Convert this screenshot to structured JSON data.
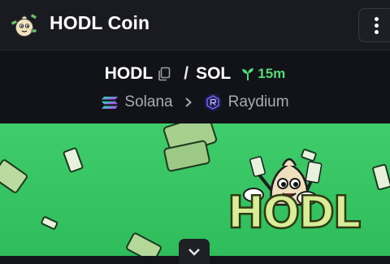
{
  "header": {
    "title": "HODL Coin",
    "logo_icon": "hodl-mascot-icon",
    "menu_icon": "kebab-menu-icon"
  },
  "pair": {
    "base": "HODL",
    "separator": "/",
    "quote": "SOL",
    "age": "15m",
    "copy_icon": "copy-icon",
    "age_icon": "sprout-icon"
  },
  "chain": {
    "network": "Solana",
    "network_icon": "solana-icon",
    "dex": "Raydium",
    "dex_icon": "raydium-icon",
    "arrow_icon": "chevron-right-icon"
  },
  "banner": {
    "brand_text": "HODL",
    "background_color": "#3ecd6a"
  },
  "expand": {
    "icon": "chevron-down-icon"
  },
  "colors": {
    "accent_green": "#55d877",
    "muted_text": "#a9abb4",
    "background": "#121318"
  }
}
